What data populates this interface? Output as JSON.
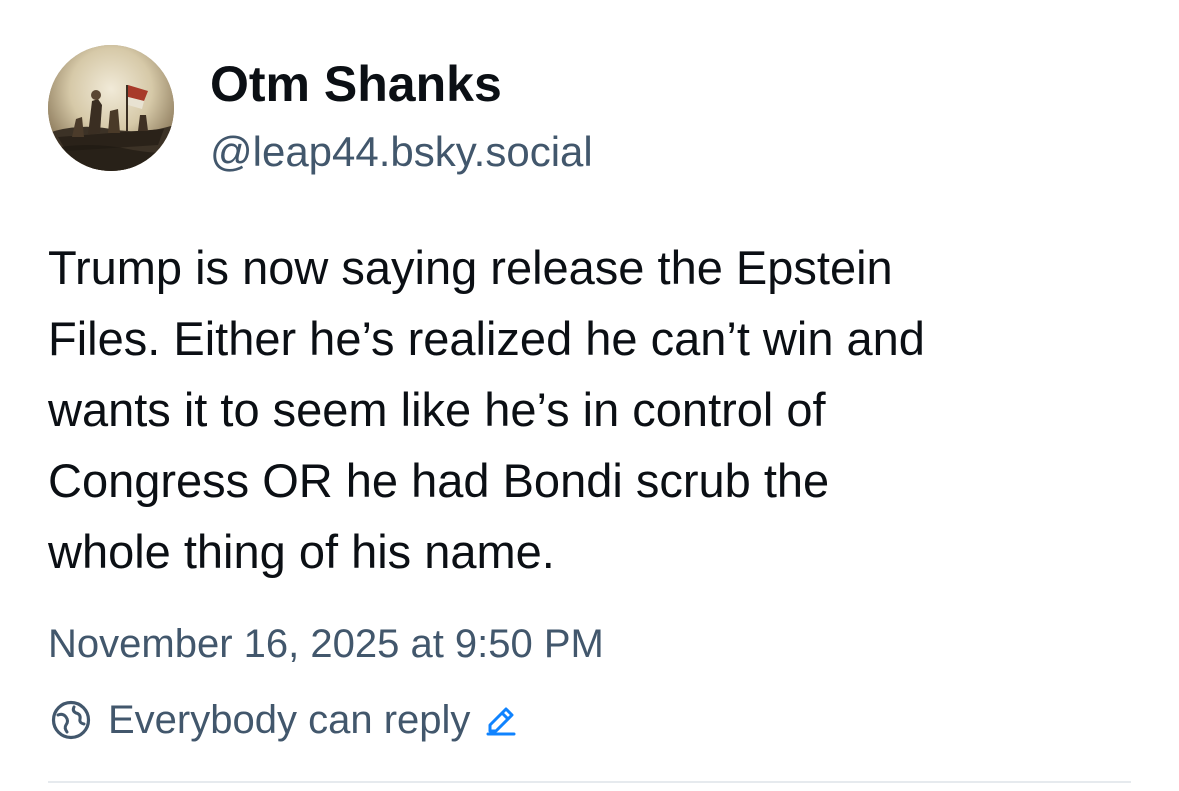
{
  "author": {
    "display_name": "Otm Shanks",
    "handle": "@leap44.bsky.social",
    "avatar_icon": "avatar-painting"
  },
  "post": {
    "lines": [
      "Trump is now saying release the Epstein",
      "Files. Either he’s realized he can’t win and",
      "wants it to seem like he’s in control of",
      "Congress OR he had Bondi scrub the",
      "whole thing of his name."
    ],
    "timestamp": "November 16, 2025 at 9:50 PM"
  },
  "reply_settings": {
    "label": "Everybody can reply",
    "icon": "globe-icon",
    "edit_icon": "pencil-icon"
  },
  "colors": {
    "text_primary": "#0b0f14",
    "text_secondary": "#42576c",
    "accent": "#1083fe",
    "divider": "#e6eaee"
  }
}
